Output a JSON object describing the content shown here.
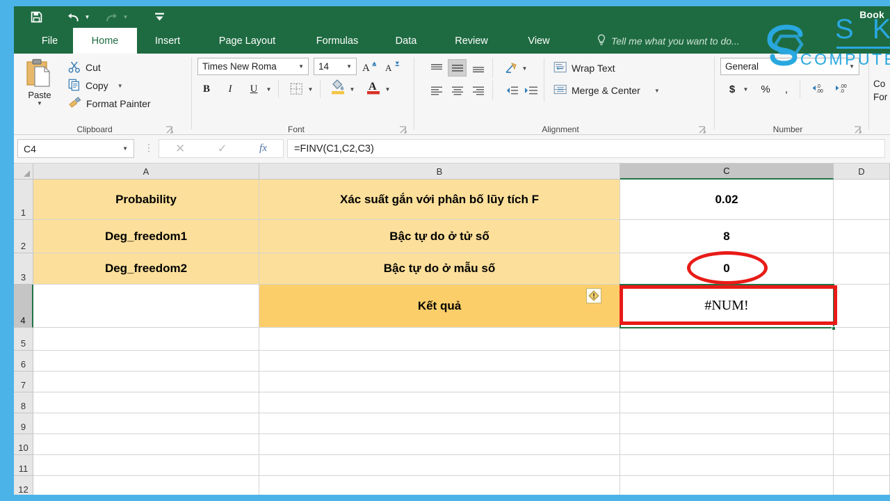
{
  "app": {
    "title": "Book",
    "accent_green": "#1e6b41",
    "frame_blue": "#4cb3e8",
    "watermark_color": "#29a8e0"
  },
  "quick_access": {
    "items": [
      {
        "name": "save-icon",
        "label": "Save",
        "enabled": true
      },
      {
        "name": "undo-icon",
        "label": "Undo",
        "enabled": true
      },
      {
        "name": "redo-icon",
        "label": "Redo",
        "enabled": false
      },
      {
        "name": "customize-qat-icon",
        "label": "Customize Quick Access Toolbar",
        "enabled": true
      }
    ]
  },
  "ribbon": {
    "tabs": [
      {
        "label": "File",
        "active": false
      },
      {
        "label": "Home",
        "active": true
      },
      {
        "label": "Insert",
        "active": false
      },
      {
        "label": "Page Layout",
        "active": false
      },
      {
        "label": "Formulas",
        "active": false
      },
      {
        "label": "Data",
        "active": false
      },
      {
        "label": "Review",
        "active": false
      },
      {
        "label": "View",
        "active": false
      }
    ],
    "tell_me": "Tell me what you want to do...",
    "groups": {
      "clipboard": {
        "label": "Clipboard",
        "paste_label": "Paste",
        "items": [
          {
            "label": "Cut",
            "icon": "scissors-icon"
          },
          {
            "label": "Copy",
            "icon": "copy-icon"
          },
          {
            "label": "Format Painter",
            "icon": "format-painter-icon"
          }
        ]
      },
      "font": {
        "label": "Font",
        "font_name": "Times New Roma",
        "font_size": "14",
        "bold": "B",
        "italic": "I",
        "underline": "U"
      },
      "alignment": {
        "label": "Alignment",
        "wrap_text": "Wrap Text",
        "merge_center": "Merge & Center"
      },
      "number": {
        "label": "Number",
        "format": "General",
        "currency": "$",
        "percent": "%",
        "comma": ","
      },
      "styles": {
        "line1": "Co",
        "line2": "For"
      }
    }
  },
  "formula_bar": {
    "name_box": "C4",
    "formula": "=FINV(C1,C2,C3)",
    "cancel_icon": "cancel-icon",
    "confirm_icon": "confirm-icon",
    "insert_function_icon": "fx-icon"
  },
  "sheet": {
    "columns": [
      "A",
      "B",
      "C",
      "D"
    ],
    "selected_column": "C",
    "selected_row": 4,
    "rows": [
      "1",
      "2",
      "3",
      "4",
      "5",
      "6",
      "7",
      "8",
      "9",
      "10",
      "11",
      "12"
    ],
    "cells": [
      {
        "ref": "A1",
        "value": "Probability",
        "fill": "fill1",
        "align": "ctr",
        "bold": true
      },
      {
        "ref": "B1",
        "value": "Xác suất gắn với phân bố lũy tích F",
        "fill": "fill1",
        "align": "ctr",
        "bold": true
      },
      {
        "ref": "C1",
        "value": "0.02",
        "fill": "white",
        "align": "ctr",
        "bold": true
      },
      {
        "ref": "D1",
        "value": "",
        "fill": "white",
        "align": "ctr",
        "bold": false
      },
      {
        "ref": "A2",
        "value": "Deg_freedom1",
        "fill": "fill1",
        "align": "ctr",
        "bold": true
      },
      {
        "ref": "B2",
        "value": "Bậc tự do ở tử số",
        "fill": "fill1",
        "align": "ctr",
        "bold": true
      },
      {
        "ref": "C2",
        "value": "8",
        "fill": "white",
        "align": "ctr",
        "bold": true
      },
      {
        "ref": "D2",
        "value": "",
        "fill": "white",
        "align": "ctr",
        "bold": false
      },
      {
        "ref": "A3",
        "value": "Deg_freedom2",
        "fill": "fill1",
        "align": "ctr",
        "bold": true
      },
      {
        "ref": "B3",
        "value": "Bậc tự do ở mẫu số",
        "fill": "fill1",
        "align": "ctr",
        "bold": true
      },
      {
        "ref": "C3",
        "value": "0",
        "fill": "white",
        "align": "ctr",
        "bold": true
      },
      {
        "ref": "D3",
        "value": "",
        "fill": "white",
        "align": "ctr",
        "bold": false
      },
      {
        "ref": "A4",
        "value": "",
        "fill": "white",
        "align": "ctr",
        "bold": false
      },
      {
        "ref": "B4",
        "value": "Kết quả",
        "fill": "fill2",
        "align": "ctr",
        "bold": true
      },
      {
        "ref": "C4",
        "value": "#NUM!",
        "fill": "white",
        "align": "ctr",
        "bold": false,
        "error": true
      },
      {
        "ref": "D4",
        "value": "",
        "fill": "white",
        "align": "ctr",
        "bold": false
      }
    ],
    "error_indicator": {
      "name": "error-warning-icon",
      "glyph": "!",
      "cell": "B4"
    }
  },
  "annotations": [
    {
      "type": "ellipse",
      "name": "annotation-ellipse-c3",
      "target": "C3",
      "color": "#e81b17"
    },
    {
      "type": "rect",
      "name": "annotation-rect-c4",
      "target": "C4",
      "color": "#e81b17"
    }
  ],
  "watermark": {
    "line1": "S K Y",
    "line2": "COMPUTER"
  }
}
